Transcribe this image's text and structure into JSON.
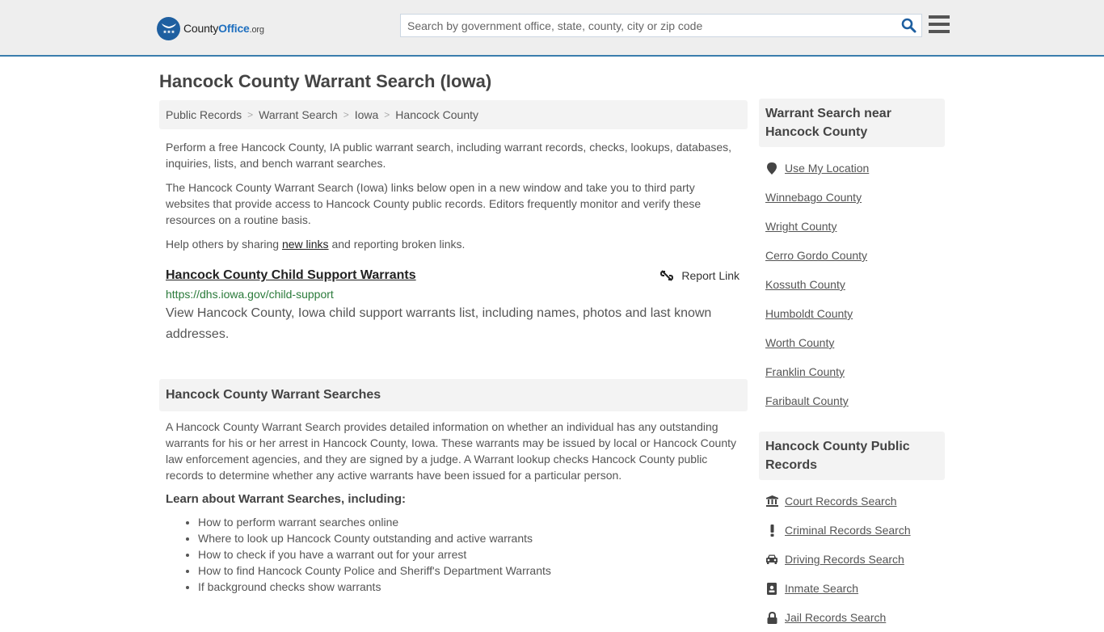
{
  "header": {
    "logo": {
      "brand_prefix": "County",
      "brand_main": "Office",
      "brand_suffix": ".org"
    },
    "search": {
      "placeholder": "Search by government office, state, county, city or zip code",
      "value": ""
    },
    "icons": {
      "search": "search-icon",
      "menu": "hamburger-menu-icon"
    }
  },
  "page": {
    "title": "Hancock County Warrant Search (Iowa)"
  },
  "breadcrumb": [
    {
      "label": "Public Records"
    },
    {
      "label": "Warrant Search"
    },
    {
      "label": "Iowa"
    },
    {
      "label": "Hancock County"
    }
  ],
  "intro": {
    "p1": "Perform a free Hancock County, IA public warrant search, including warrant records, checks, lookups, databases, inquiries, lists, and bench warrant searches.",
    "p2": "The Hancock County Warrant Search (Iowa) links below open in a new window and take you to third party websites that provide access to Hancock County public records. Editors frequently monitor and verify these resources on a routine basis.",
    "p3_before": "Help others by sharing ",
    "p3_link": "new links",
    "p3_after": " and reporting broken links."
  },
  "results": [
    {
      "title": "Hancock County Child Support Warrants",
      "url": "https://dhs.iowa.gov/child-support",
      "description": "View Hancock County, Iowa child support warrants list, including names, photos and last known addresses.",
      "report_label": "Report Link"
    }
  ],
  "warrant_searches": {
    "heading": "Hancock County Warrant Searches",
    "body": "A Hancock County Warrant Search provides detailed information on whether an individual has any outstanding warrants for his or her arrest in Hancock County, Iowa. These warrants may be issued by local or Hancock County law enforcement agencies, and they are signed by a judge. A Warrant lookup checks Hancock County public records to determine whether any active warrants have been issued for a particular person.",
    "learn_heading": "Learn about Warrant Searches, including:",
    "learn_items": [
      "How to perform warrant searches online",
      "Where to look up Hancock County outstanding and active warrants",
      "How to check if you have a warrant out for your arrest",
      "How to find Hancock County Police and Sheriff's Department Warrants",
      "If background checks show warrants"
    ]
  },
  "sidebar": {
    "nearby": {
      "heading": "Warrant Search near Hancock County",
      "use_location": "Use My Location",
      "counties": [
        "Winnebago County",
        "Wright County",
        "Cerro Gordo County",
        "Kossuth County",
        "Humboldt County",
        "Worth County",
        "Franklin County",
        "Faribault County"
      ]
    },
    "public_records": {
      "heading": "Hancock County Public Records",
      "items": [
        {
          "label": "Court Records Search",
          "icon": "courthouse-icon"
        },
        {
          "label": "Criminal Records Search",
          "icon": "exclamation-icon"
        },
        {
          "label": "Driving Records Search",
          "icon": "car-icon"
        },
        {
          "label": "Inmate Search",
          "icon": "id-badge-icon"
        },
        {
          "label": "Jail Records Search",
          "icon": "lock-icon"
        }
      ]
    }
  },
  "colors": {
    "brand_blue": "#1e5fa0",
    "header_bg": "#eeeeee",
    "header_border": "#3a7dad",
    "url_green": "#2a7a3a",
    "panel_bg": "#f3f3f3"
  }
}
